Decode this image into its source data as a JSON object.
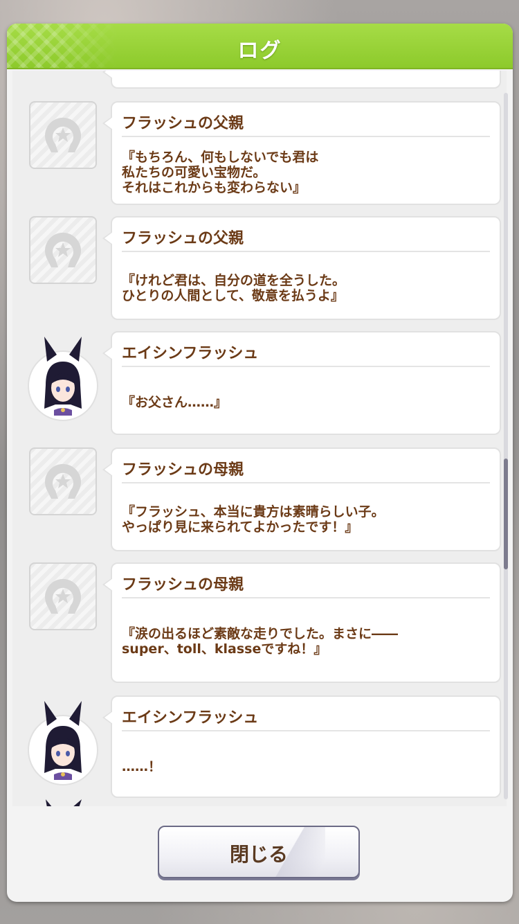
{
  "dialog": {
    "title": "ログ",
    "close_label": "閉じる"
  },
  "entries": [
    {
      "speaker": "フラッシュの父親",
      "text": "『もちろん、何もしないでも君は\n私たちの可愛い宝物だ。\nそれはこれからも変わらない』",
      "avatar": "horseshoe-placeholder-icon"
    },
    {
      "speaker": "フラッシュの父親",
      "text": "『けれど君は、自分の道を全うした。\nひとりの人間として、敬意を払うよ』",
      "avatar": "horseshoe-placeholder-icon"
    },
    {
      "speaker": "エイシンフラッシュ",
      "text": "『お父さん……』",
      "avatar": "character-portrait"
    },
    {
      "speaker": "フラッシュの母親",
      "text": "『フラッシュ、本当に貴方は素晴らしい子。\nやっぱり見に来られてよかったです！』",
      "avatar": "horseshoe-placeholder-icon"
    },
    {
      "speaker": "フラッシュの母親",
      "text": "『涙の出るほど素敵な走りでした。まさに――\nsuper、toll、klasseですね！』",
      "avatar": "horseshoe-placeholder-icon"
    },
    {
      "speaker": "エイシンフラッシュ",
      "text": "……！",
      "avatar": "character-portrait"
    }
  ],
  "colors": {
    "header_green": "#8dca2b",
    "text_brown": "#6b3a16",
    "button_border": "#6b6a85"
  }
}
